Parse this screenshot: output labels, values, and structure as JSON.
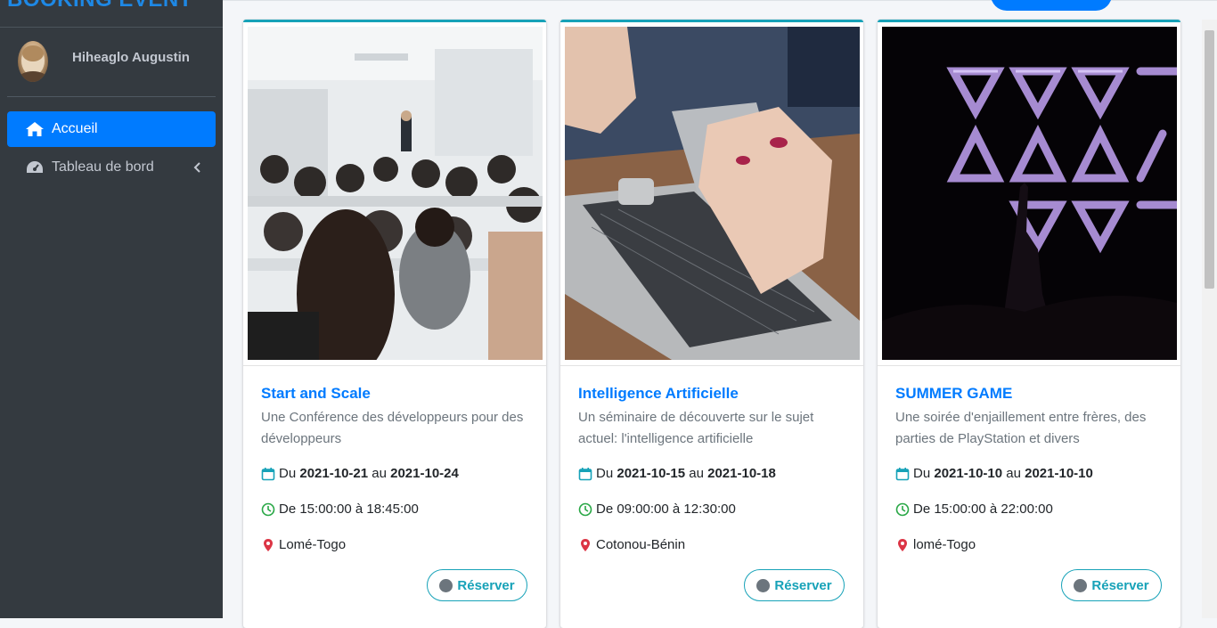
{
  "sidebar": {
    "brand": "BOOKING EVENT",
    "user_name": "Hiheaglo Augustin",
    "items": [
      {
        "label": "Accueil",
        "icon": "home-icon",
        "active": true
      },
      {
        "label": "Tableau de bord",
        "icon": "tachometer-icon",
        "active": false
      }
    ]
  },
  "events": [
    {
      "title": "Start and Scale",
      "description": "Une Conférence des développeurs pour des développeurs",
      "date_prefix": "Du",
      "date_start": "2021-10-21",
      "date_mid": "au",
      "date_end": "2021-10-24",
      "time": "De 15:00:00 à 18:45:00",
      "location": "Lomé-Togo",
      "button": "Réserver",
      "image": "conference-room-photo"
    },
    {
      "title": "Intelligence Artificielle",
      "description": "Un séminaire de découverte sur le sujet actuel: l'intelligence artificielle",
      "date_prefix": "Du",
      "date_start": "2021-10-15",
      "date_mid": "au",
      "date_end": "2021-10-18",
      "time": "De 09:00:00 à 12:30:00",
      "location": "Cotonou-Bénin",
      "button": "Réserver",
      "image": "phone-laptop-photo"
    },
    {
      "title": "SUMMER GAME",
      "description": "Une soirée d'enjaillement entre frères, des parties de PlayStation et divers",
      "date_prefix": "Du",
      "date_start": "2021-10-10",
      "date_mid": "au",
      "date_end": "2021-10-10",
      "time": "De 15:00:00 à 22:00:00",
      "location": "lomé-Togo",
      "button": "Réserver",
      "image": "neon-concert-photo"
    }
  ],
  "colors": {
    "sidebar_bg": "#343a40",
    "accent": "#007bff",
    "card_border": "#17a2b8",
    "calendar_icon": "#17a2b8",
    "clock_icon": "#28a745",
    "marker_icon": "#dc3545"
  }
}
